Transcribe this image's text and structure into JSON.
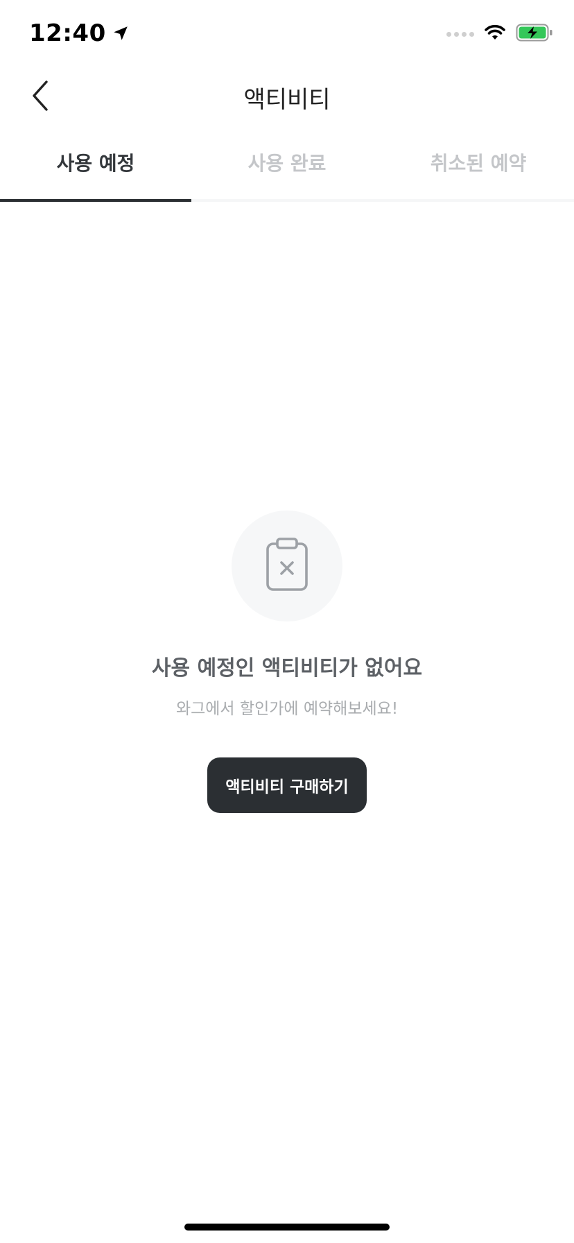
{
  "status_bar": {
    "time": "12:40",
    "icons": [
      "location-arrow-icon",
      "signal-dots-icon",
      "wifi-icon",
      "battery-charging-icon"
    ]
  },
  "header": {
    "title": "액티비티",
    "back_icon": "chevron-left-icon"
  },
  "tabs": [
    {
      "label": "사용 예정",
      "active": true
    },
    {
      "label": "사용 완료",
      "active": false
    },
    {
      "label": "취소된 예약",
      "active": false
    }
  ],
  "empty_state": {
    "icon": "clipboard-x-icon",
    "title": "사용 예정인 액티비티가 없어요",
    "subtitle": "와그에서 할인가에 예약해보세요!",
    "button_label": "액티비티 구매하기"
  },
  "colors": {
    "text_dark": "#33373b",
    "text_inactive": "#c4c6c9",
    "button_bg": "#2b2f33",
    "battery_green": "#34c759"
  }
}
